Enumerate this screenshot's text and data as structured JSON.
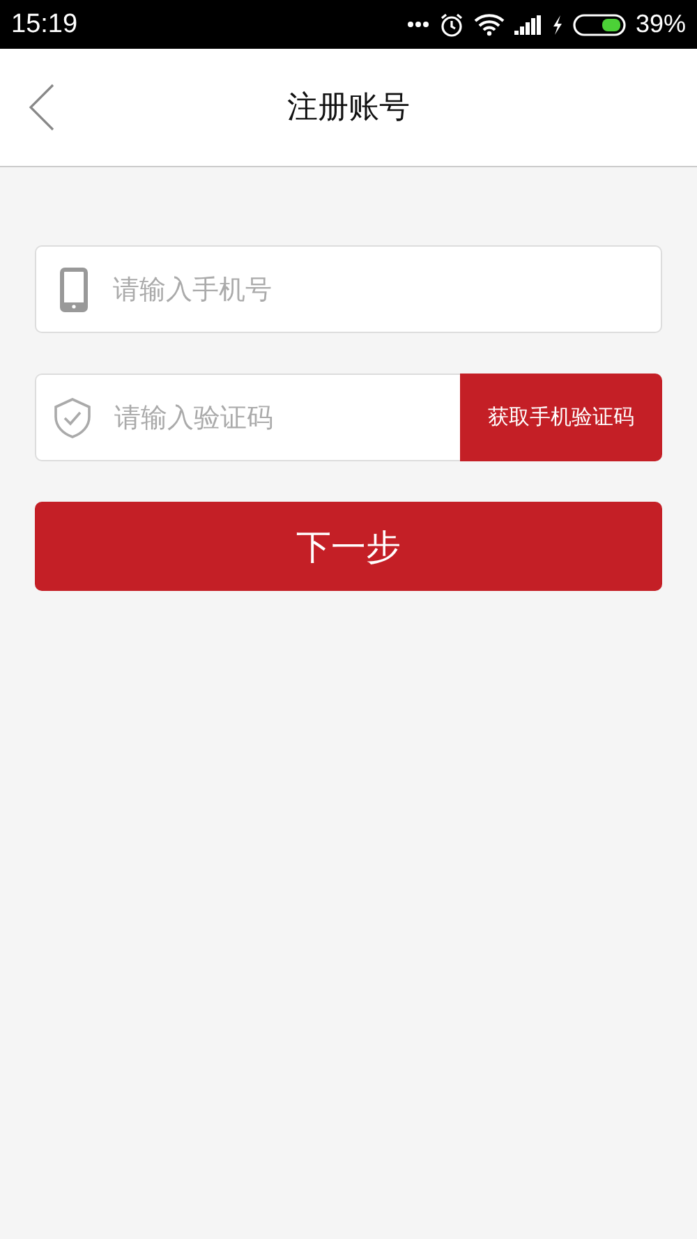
{
  "status_bar": {
    "time": "15:19",
    "battery": "39%"
  },
  "header": {
    "title": "注册账号"
  },
  "phone_field": {
    "placeholder": "请输入手机号"
  },
  "code_field": {
    "placeholder": "请输入验证码"
  },
  "get_code_button": {
    "label": "获取手机验证码"
  },
  "next_button": {
    "label": "下一步"
  }
}
